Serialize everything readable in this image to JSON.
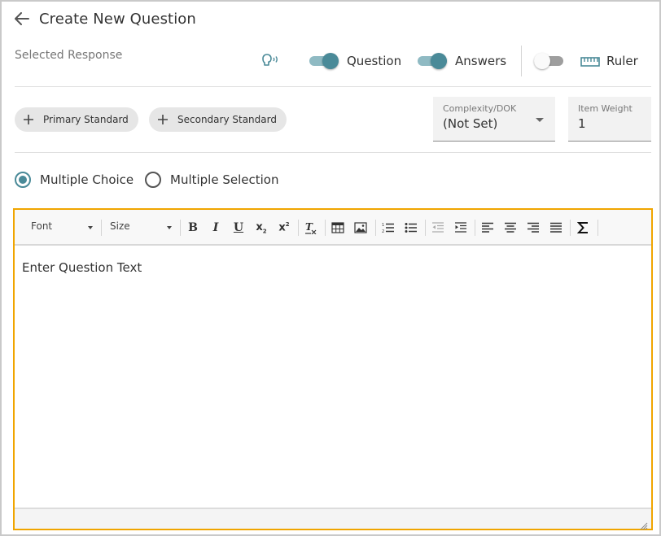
{
  "header": {
    "title": "Create New Question"
  },
  "subtitle": "Selected Response",
  "toggles": {
    "question": {
      "label": "Question",
      "on": true
    },
    "answers": {
      "label": "Answers",
      "on": true
    },
    "ruler": {
      "label": "Ruler",
      "on": false
    }
  },
  "standards": {
    "primary_label": "Primary Standard",
    "secondary_label": "Secondary Standard"
  },
  "complexity": {
    "label": "Complexity/DOK",
    "value": "(Not Set)"
  },
  "item_weight": {
    "label": "Item Weight",
    "value": "1"
  },
  "question_type": {
    "options": [
      {
        "label": "Multiple Choice",
        "selected": true
      },
      {
        "label": "Multiple Selection",
        "selected": false
      }
    ]
  },
  "editor": {
    "font_label": "Font",
    "size_label": "Size",
    "buttons": [
      "bold",
      "italic",
      "underline",
      "subscript",
      "superscript",
      "remove-format",
      "table",
      "image",
      "numbered-list",
      "bulleted-list",
      "decrease-indent",
      "increase-indent",
      "align-left",
      "align-center",
      "align-right",
      "justify",
      "sigma"
    ],
    "placeholder": "Enter Question Text"
  },
  "colors": {
    "accent": "#4a8a98",
    "editor_border": "#f0a500"
  }
}
